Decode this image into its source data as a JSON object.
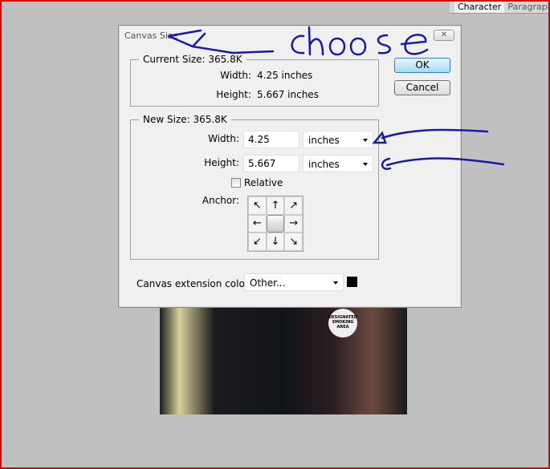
{
  "panel_tabs": [
    {
      "label": "Character",
      "active": true
    },
    {
      "label": "Paragraph",
      "active": false
    }
  ],
  "dialog": {
    "title": "Canvas Size",
    "close_icon": "close-icon",
    "current_size": {
      "label": "Current Size: 365.8K",
      "width_label": "Width:",
      "width_value": "4.25 inches",
      "height_label": "Height:",
      "height_value": "5.667 inches"
    },
    "new_size": {
      "label": "New Size: 365.8K",
      "width_label": "Width:",
      "width_value": "4.25",
      "width_unit": "inches",
      "height_label": "Height:",
      "height_value": "5.667",
      "height_unit": "inches",
      "relative_label": "Relative",
      "relative_checked": false,
      "anchor_label": "Anchor:",
      "anchor_arrows": [
        "↖",
        "↑",
        "↗",
        "←",
        "",
        "→",
        "↙",
        "↓",
        "↘"
      ]
    },
    "extension": {
      "label": "Canvas extension color:",
      "value": "Other...",
      "swatch_color": "#000000"
    },
    "ok_label": "OK",
    "cancel_label": "Cancel"
  },
  "annotation": {
    "text": "choose",
    "ink_color": "#1a1aa8"
  },
  "photo": {
    "sign_text": "DESIGNATED SMOKING AREA"
  }
}
